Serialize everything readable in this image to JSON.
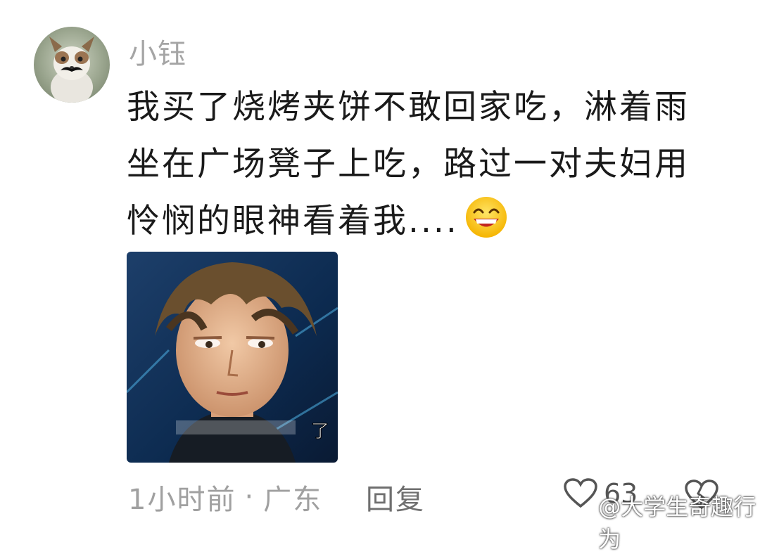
{
  "comment": {
    "username": "小钰",
    "body_lines": [
      "我买了烧烤夹饼不敢回家吃，淋着雨",
      "坐在广场凳子上吃，路过一对夫妇用",
      "怜悯的眼神看着我...."
    ],
    "body_emoji": "grinning-face-icon",
    "image_caption": "了",
    "time": "1小时前",
    "separator": "·",
    "location": "广东",
    "reply_label": "回复",
    "like_count": "63"
  },
  "watermark": {
    "text": "@大学生奇趣行为"
  },
  "colors": {
    "username": "#a5a5a5",
    "body_text": "#1a1a1a",
    "meta_text": "#a0a0a0",
    "background": "#ffffff"
  }
}
